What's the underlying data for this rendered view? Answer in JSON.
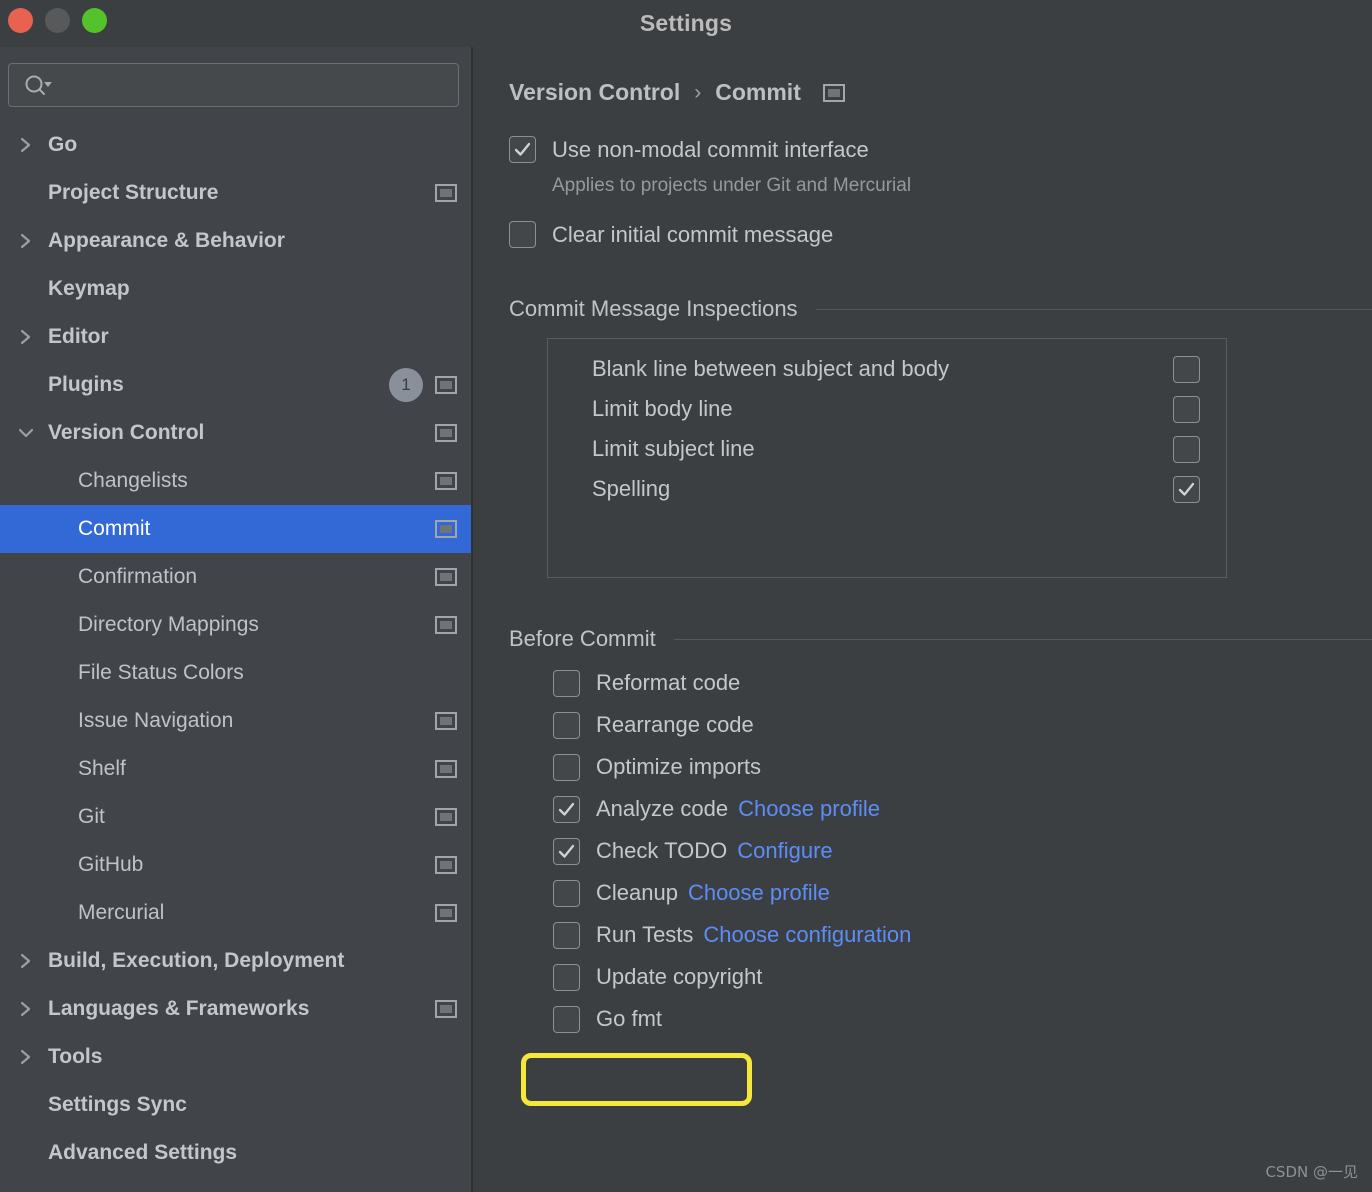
{
  "window": {
    "title": "Settings",
    "traffic_lights": [
      {
        "name": "close",
        "color": "#e96150"
      },
      {
        "name": "minimize",
        "color": "#57595b"
      },
      {
        "name": "maximize",
        "color": "#53c22b"
      }
    ]
  },
  "colors": {
    "selection_blue": "#3369d6",
    "link_blue": "#5c8df6",
    "highlight_yellow": "#f5e73c",
    "sidebar_bg": "#41454a",
    "main_bg": "#3c3f41"
  },
  "sidebar": {
    "search": {
      "value": "",
      "placeholder": "",
      "icon": "search-icon"
    },
    "items": [
      {
        "label": "Go",
        "level": 0,
        "chevron": "right",
        "bold": true,
        "selected": false,
        "badge": null,
        "window_icon": false
      },
      {
        "label": "Project Structure",
        "level": 0,
        "chevron": "none",
        "bold": true,
        "selected": false,
        "badge": null,
        "window_icon": true
      },
      {
        "label": "Appearance & Behavior",
        "level": 0,
        "chevron": "right",
        "bold": true,
        "selected": false,
        "badge": null,
        "window_icon": false
      },
      {
        "label": "Keymap",
        "level": 0,
        "chevron": "none",
        "bold": true,
        "selected": false,
        "badge": null,
        "window_icon": false
      },
      {
        "label": "Editor",
        "level": 0,
        "chevron": "right",
        "bold": true,
        "selected": false,
        "badge": null,
        "window_icon": false
      },
      {
        "label": "Plugins",
        "level": 0,
        "chevron": "none",
        "bold": true,
        "selected": false,
        "badge": "1",
        "window_icon": true
      },
      {
        "label": "Version Control",
        "level": 0,
        "chevron": "down",
        "bold": true,
        "selected": false,
        "badge": null,
        "window_icon": true
      },
      {
        "label": "Changelists",
        "level": 1,
        "chevron": "none",
        "bold": false,
        "selected": false,
        "badge": null,
        "window_icon": true
      },
      {
        "label": "Commit",
        "level": 1,
        "chevron": "none",
        "bold": false,
        "selected": true,
        "badge": null,
        "window_icon": true
      },
      {
        "label": "Confirmation",
        "level": 1,
        "chevron": "none",
        "bold": false,
        "selected": false,
        "badge": null,
        "window_icon": true
      },
      {
        "label": "Directory Mappings",
        "level": 1,
        "chevron": "none",
        "bold": false,
        "selected": false,
        "badge": null,
        "window_icon": true
      },
      {
        "label": "File Status Colors",
        "level": 1,
        "chevron": "none",
        "bold": false,
        "selected": false,
        "badge": null,
        "window_icon": false
      },
      {
        "label": "Issue Navigation",
        "level": 1,
        "chevron": "none",
        "bold": false,
        "selected": false,
        "badge": null,
        "window_icon": true
      },
      {
        "label": "Shelf",
        "level": 1,
        "chevron": "none",
        "bold": false,
        "selected": false,
        "badge": null,
        "window_icon": true
      },
      {
        "label": "Git",
        "level": 1,
        "chevron": "none",
        "bold": false,
        "selected": false,
        "badge": null,
        "window_icon": true
      },
      {
        "label": "GitHub",
        "level": 1,
        "chevron": "none",
        "bold": false,
        "selected": false,
        "badge": null,
        "window_icon": true
      },
      {
        "label": "Mercurial",
        "level": 1,
        "chevron": "none",
        "bold": false,
        "selected": false,
        "badge": null,
        "window_icon": true
      },
      {
        "label": "Build, Execution, Deployment",
        "level": 0,
        "chevron": "right",
        "bold": true,
        "selected": false,
        "badge": null,
        "window_icon": false
      },
      {
        "label": "Languages & Frameworks",
        "level": 0,
        "chevron": "right",
        "bold": true,
        "selected": false,
        "badge": null,
        "window_icon": true
      },
      {
        "label": "Tools",
        "level": 0,
        "chevron": "right",
        "bold": true,
        "selected": false,
        "badge": null,
        "window_icon": false
      },
      {
        "label": "Settings Sync",
        "level": 0,
        "chevron": "none",
        "bold": true,
        "selected": false,
        "badge": null,
        "window_icon": false
      },
      {
        "label": "Advanced Settings",
        "level": 0,
        "chevron": "none",
        "bold": true,
        "selected": false,
        "badge": null,
        "window_icon": false
      }
    ]
  },
  "main": {
    "breadcrumb": {
      "parent": "Version Control",
      "separator": "›",
      "current": "Commit",
      "icon": "window-icon"
    },
    "top_options": [
      {
        "label": "Use non-modal commit interface",
        "checked": true,
        "hint": "Applies to projects under Git and Mercurial"
      },
      {
        "label": "Clear initial commit message",
        "checked": false,
        "hint": null
      }
    ],
    "inspections": {
      "section_title": "Commit Message Inspections",
      "rows": [
        {
          "label": "Blank line between subject and body",
          "checked": false
        },
        {
          "label": "Limit body line",
          "checked": false
        },
        {
          "label": "Limit subject line",
          "checked": false
        },
        {
          "label": "Spelling",
          "checked": true
        }
      ]
    },
    "before_commit": {
      "section_title": "Before Commit",
      "rows": [
        {
          "label": "Reformat code",
          "checked": false,
          "link": null,
          "highlighted": false
        },
        {
          "label": "Rearrange code",
          "checked": false,
          "link": null,
          "highlighted": false
        },
        {
          "label": "Optimize imports",
          "checked": false,
          "link": null,
          "highlighted": false
        },
        {
          "label": "Analyze code",
          "checked": true,
          "link": "Choose profile",
          "highlighted": false
        },
        {
          "label": "Check TODO",
          "checked": true,
          "link": "Configure",
          "highlighted": false
        },
        {
          "label": "Cleanup",
          "checked": false,
          "link": "Choose profile",
          "highlighted": false
        },
        {
          "label": "Run Tests",
          "checked": false,
          "link": "Choose configuration",
          "highlighted": false
        },
        {
          "label": "Update copyright",
          "checked": false,
          "link": null,
          "highlighted": false
        },
        {
          "label": "Go fmt",
          "checked": false,
          "link": null,
          "highlighted": true
        }
      ]
    }
  },
  "watermark": "CSDN @一见"
}
